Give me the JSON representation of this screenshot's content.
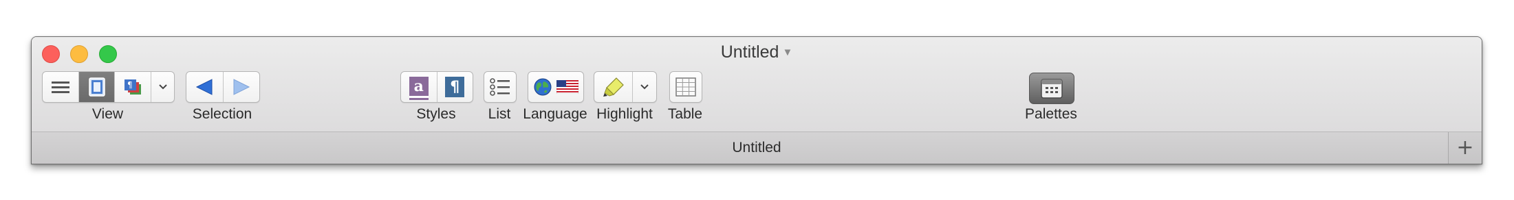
{
  "window": {
    "title": "Untitled"
  },
  "toolbar": {
    "view": {
      "label": "View"
    },
    "selection": {
      "label": "Selection"
    },
    "styles": {
      "label": "Styles",
      "char_style_glyph": "a",
      "para_style_glyph": "¶"
    },
    "list": {
      "label": "List"
    },
    "language": {
      "label": "Language"
    },
    "highlight": {
      "label": "Highlight"
    },
    "table": {
      "label": "Table"
    },
    "palettes": {
      "label": "Palettes"
    }
  },
  "tab": {
    "title": "Untitled",
    "add_glyph": "+"
  },
  "icons": {
    "sidebar": "list-lines-icon",
    "page_view": "page-view-icon",
    "layout": "layout-stack-icon",
    "back": "triangle-left-icon",
    "forward": "triangle-right-icon",
    "char_style": "character-style-icon",
    "para_style": "paragraph-style-icon",
    "list": "bullet-list-icon",
    "globe": "globe-icon",
    "flag": "us-flag-icon",
    "highlighter": "highlighter-icon",
    "table": "table-grid-icon",
    "palettes": "palettes-icon"
  },
  "colors": {
    "close": "#fc605c",
    "minimize": "#fdbc40",
    "maximize": "#34c84a",
    "nav_blue": "#2f6fd6",
    "style_purple": "#8a6a9a",
    "style_blue": "#3e6c9a"
  }
}
